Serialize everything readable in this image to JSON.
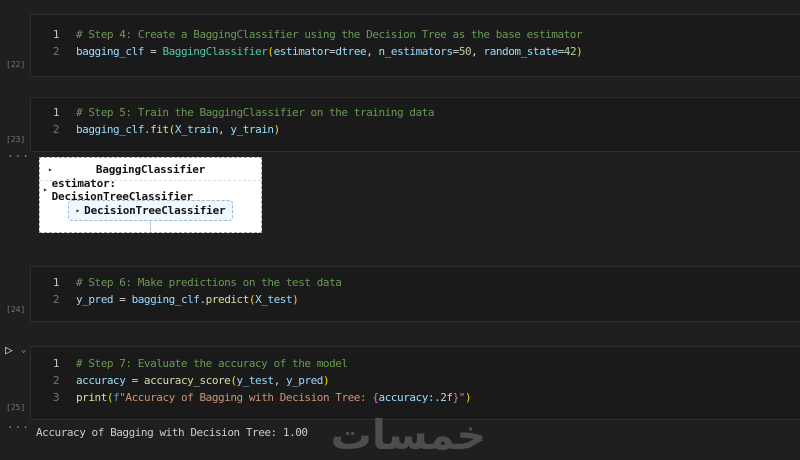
{
  "syntax_colors": {
    "comment": "#6a9955",
    "variable": "#9cdcfe",
    "class": "#4ec9b0",
    "function": "#dcdcaa",
    "number": "#b5cea8",
    "string": "#ce9178",
    "keyword": "#569cd6",
    "punct": "#d4d4d4",
    "bracket1": "#ffd700",
    "bracket2": "#da70d6"
  },
  "cells": [
    {
      "execution_count": "[22]",
      "lines": [
        {
          "num": "1",
          "tokens": [
            [
              "# Step 4: Create a BaggingClassifier using the Decision Tree as the base estimator",
              "comment"
            ]
          ]
        },
        {
          "num": "2",
          "tokens": [
            [
              "bagging_clf",
              "variable"
            ],
            [
              " = ",
              "punct"
            ],
            [
              "BaggingClassifier",
              "class"
            ],
            [
              "(",
              "bracket1"
            ],
            [
              "estimator",
              "variable"
            ],
            [
              "=",
              "punct"
            ],
            [
              "dtree",
              "variable"
            ],
            [
              ", ",
              "punct"
            ],
            [
              "n_estimators",
              "variable"
            ],
            [
              "=",
              "punct"
            ],
            [
              "50",
              "number"
            ],
            [
              ", ",
              "punct"
            ],
            [
              "random_state",
              "variable"
            ],
            [
              "=",
              "punct"
            ],
            [
              "42",
              "number"
            ],
            [
              ")",
              "bracket1"
            ]
          ]
        }
      ]
    },
    {
      "execution_count": "[23]",
      "lines": [
        {
          "num": "1",
          "tokens": [
            [
              "# Step 5: Train the BaggingClassifier on the training data",
              "comment"
            ]
          ]
        },
        {
          "num": "2",
          "tokens": [
            [
              "bagging_clf",
              "variable"
            ],
            [
              ".",
              "punct"
            ],
            [
              "fit",
              "function"
            ],
            [
              "(",
              "bracket1"
            ],
            [
              "X_train",
              "variable"
            ],
            [
              ", ",
              "punct"
            ],
            [
              "y_train",
              "variable"
            ],
            [
              ")",
              "bracket1"
            ]
          ]
        }
      ]
    },
    {
      "execution_count": "[24]",
      "lines": [
        {
          "num": "1",
          "tokens": [
            [
              "# Step 6: Make predictions on the test data",
              "comment"
            ]
          ]
        },
        {
          "num": "2",
          "tokens": [
            [
              "y_pred",
              "variable"
            ],
            [
              " = ",
              "punct"
            ],
            [
              "bagging_clf",
              "variable"
            ],
            [
              ".",
              "punct"
            ],
            [
              "predict",
              "function"
            ],
            [
              "(",
              "bracket1"
            ],
            [
              "X_test",
              "variable"
            ],
            [
              ")",
              "bracket1"
            ]
          ]
        }
      ]
    },
    {
      "execution_count": "[25]",
      "lines": [
        {
          "num": "1",
          "tokens": [
            [
              "# Step 7: Evaluate the accuracy of the model",
              "comment"
            ]
          ]
        },
        {
          "num": "2",
          "tokens": [
            [
              "accuracy",
              "variable"
            ],
            [
              " = ",
              "punct"
            ],
            [
              "accuracy_score",
              "function"
            ],
            [
              "(",
              "bracket1"
            ],
            [
              "y_test",
              "variable"
            ],
            [
              ", ",
              "punct"
            ],
            [
              "y_pred",
              "variable"
            ],
            [
              ")",
              "bracket1"
            ]
          ]
        },
        {
          "num": "3",
          "tokens": [
            [
              "print",
              "function"
            ],
            [
              "(",
              "bracket1"
            ],
            [
              "f",
              "keyword"
            ],
            [
              "\"Accuracy of Bagging with Decision Tree: ",
              "string"
            ],
            [
              "{",
              "bracket2"
            ],
            [
              "accuracy:.2f",
              "variable"
            ],
            [
              "}",
              "bracket2"
            ],
            [
              "\"",
              "string"
            ],
            [
              ")",
              "bracket1"
            ]
          ]
        }
      ]
    }
  ],
  "gutter": {
    "run_icon": "▷",
    "run_chevron": "⌄",
    "collapse_dots": "···"
  },
  "estimator_widget": {
    "caret": "▸",
    "title": "BaggingClassifier",
    "estimator_row": "estimator: DecisionTreeClassifier",
    "inner_label": "DecisionTreeClassifier"
  },
  "stream_output": {
    "text": "Accuracy of Bagging with Decision Tree: 1.00"
  },
  "watermark": {
    "text": "خمسات"
  }
}
